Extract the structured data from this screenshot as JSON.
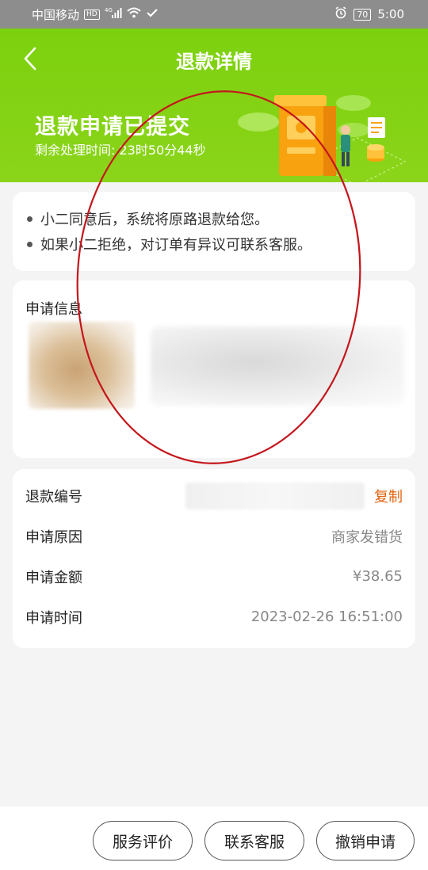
{
  "status_bar": {
    "carrier": "中国移动",
    "hd": "HD",
    "network": "4G",
    "battery": "70",
    "time": "5:00"
  },
  "nav": {
    "title": "退款详情",
    "back_icon": "chevron-left-icon"
  },
  "refund_status": {
    "title": "退款申请已提交",
    "remaining_label": "剩余处理时间:",
    "remaining_time": "23时50分44秒"
  },
  "notices": [
    "小二同意后，系统将原路退款给您。",
    "如果小二拒绝，对订单有异议可联系客服。"
  ],
  "apply_info": {
    "title": "申请信息"
  },
  "details": {
    "refund_no_label": "退款编号",
    "copy_label": "复制",
    "reason_label": "申请原因",
    "reason_value": "商家发错货",
    "amount_label": "申请金额",
    "amount_value": "¥38.65",
    "time_label": "申请时间",
    "time_value": "2023-02-26 16:51:00"
  },
  "actions": {
    "review": "服务评价",
    "contact": "联系客服",
    "cancel": "撤销申请"
  },
  "colors": {
    "header_green": "#7cd10e",
    "copy_orange": "#e2620e",
    "annotation_red": "#c4161c"
  }
}
